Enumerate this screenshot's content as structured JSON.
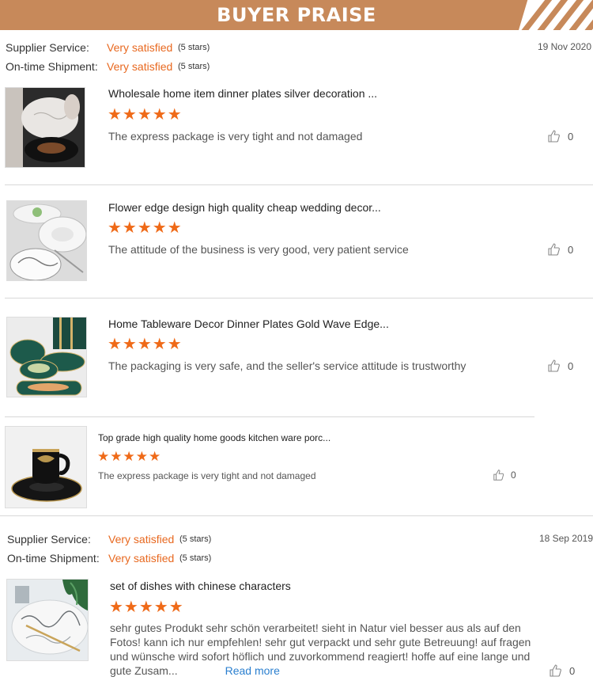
{
  "banner": {
    "title": "BUYER PRAISE"
  },
  "reviews": [
    {
      "supplier_label": "Supplier Service:",
      "supplier_value": "Very satisfied",
      "supplier_stars": "(5 stars)",
      "shipment_label": "On-time Shipment:",
      "shipment_value": "Very satisfied",
      "shipment_stars": "(5 stars)",
      "date": "19 Nov 2020",
      "items": [
        {
          "title": "Wholesale home item dinner plates silver decoration ...",
          "stars": "★★★★★",
          "comment": "The express package is very tight and not damaged",
          "likes": "0"
        },
        {
          "title": "Flower edge design high quality cheap wedding decor...",
          "stars": "★★★★★",
          "comment": "The attitude of the business is very good, very patient service",
          "likes": "0"
        },
        {
          "title": "Home Tableware Decor Dinner Plates Gold Wave Edge...",
          "stars": "★★★★★",
          "comment": "The packaging is very safe, and the seller's service attitude is trustworthy",
          "likes": "0"
        },
        {
          "title": "Top grade high quality home goods kitchen ware porc...",
          "stars": "★★★★★",
          "comment": "The express package is very tight and not damaged",
          "likes": "0"
        }
      ]
    },
    {
      "supplier_label": "Supplier Service:",
      "supplier_value": "Very satisfied",
      "supplier_stars": "(5 stars)",
      "shipment_label": "On-time Shipment:",
      "shipment_value": "Very satisfied",
      "shipment_stars": "(5 stars)",
      "date": "18 Sep 2019",
      "items": [
        {
          "title": "set of dishes with chinese characters",
          "stars": "★★★★★",
          "comment": "sehr gutes Produkt sehr schön verarbeitet! sieht in Natur viel besser aus als auf den Fotos! kann ich nur empfehlen! sehr gut verpackt und sehr gute Betreuung! auf fragen und wünsche wird sofort höflich und zuvorkommend reagiert! hoffe auf eine lange und gute Zusam...",
          "read_more": "Read more",
          "likes": "0"
        }
      ]
    }
  ]
}
